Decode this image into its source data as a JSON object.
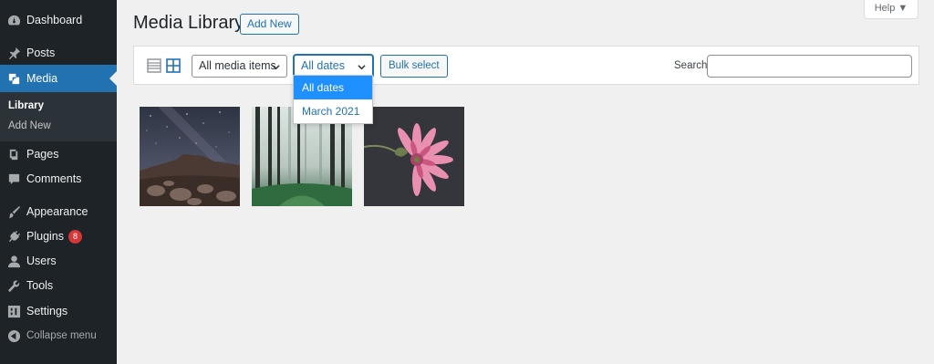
{
  "sidebar": {
    "items": [
      {
        "id": "dashboard",
        "label": "Dashboard",
        "icon": "dashboard-icon"
      },
      {
        "id": "posts",
        "label": "Posts",
        "icon": "pin-icon"
      },
      {
        "id": "media",
        "label": "Media",
        "icon": "media-icon",
        "active": true
      },
      {
        "id": "pages",
        "label": "Pages",
        "icon": "pages-icon"
      },
      {
        "id": "comments",
        "label": "Comments",
        "icon": "comment-icon"
      },
      {
        "id": "appearance",
        "label": "Appearance",
        "icon": "brush-icon"
      },
      {
        "id": "plugins",
        "label": "Plugins",
        "icon": "plugin-icon",
        "badge": "8"
      },
      {
        "id": "users",
        "label": "Users",
        "icon": "user-icon"
      },
      {
        "id": "tools",
        "label": "Tools",
        "icon": "wrench-icon"
      },
      {
        "id": "settings",
        "label": "Settings",
        "icon": "settings-icon"
      },
      {
        "id": "collapse",
        "label": "Collapse menu",
        "icon": "collapse-arrow-icon"
      }
    ],
    "submenu": [
      {
        "label": "Library",
        "current": true
      },
      {
        "label": "Add New",
        "current": false
      }
    ]
  },
  "header": {
    "title": "Media Library",
    "add_new_label": "Add New",
    "help_label": "Help ▼"
  },
  "toolbar": {
    "views": [
      "list-view-icon",
      "grid-view-icon"
    ],
    "active_view": "grid",
    "media_type_filter": "All media items",
    "date_filter": "All dates",
    "bulk_select_label": "Bulk select",
    "search_label": "Search",
    "search_value": "",
    "search_placeholder": ""
  },
  "date_dropdown": {
    "options": [
      "All dates",
      "March 2021"
    ],
    "selected": "All dates"
  },
  "media_items": [
    {
      "name": "night-sky-landscape-thumbnail",
      "subject": "starry night sky over rocky desert"
    },
    {
      "name": "foggy-forest-thumbnail",
      "subject": "misty forest with tall trees"
    },
    {
      "name": "pink-flower-thumbnail",
      "subject": "pink flower on dark background"
    }
  ],
  "colors": {
    "sidebar_bg": "#1d2327",
    "accent": "#2271b1",
    "page_bg": "#f0f0f1",
    "badge": "#d63638",
    "dropdown_highlight": "#1e90ff"
  }
}
